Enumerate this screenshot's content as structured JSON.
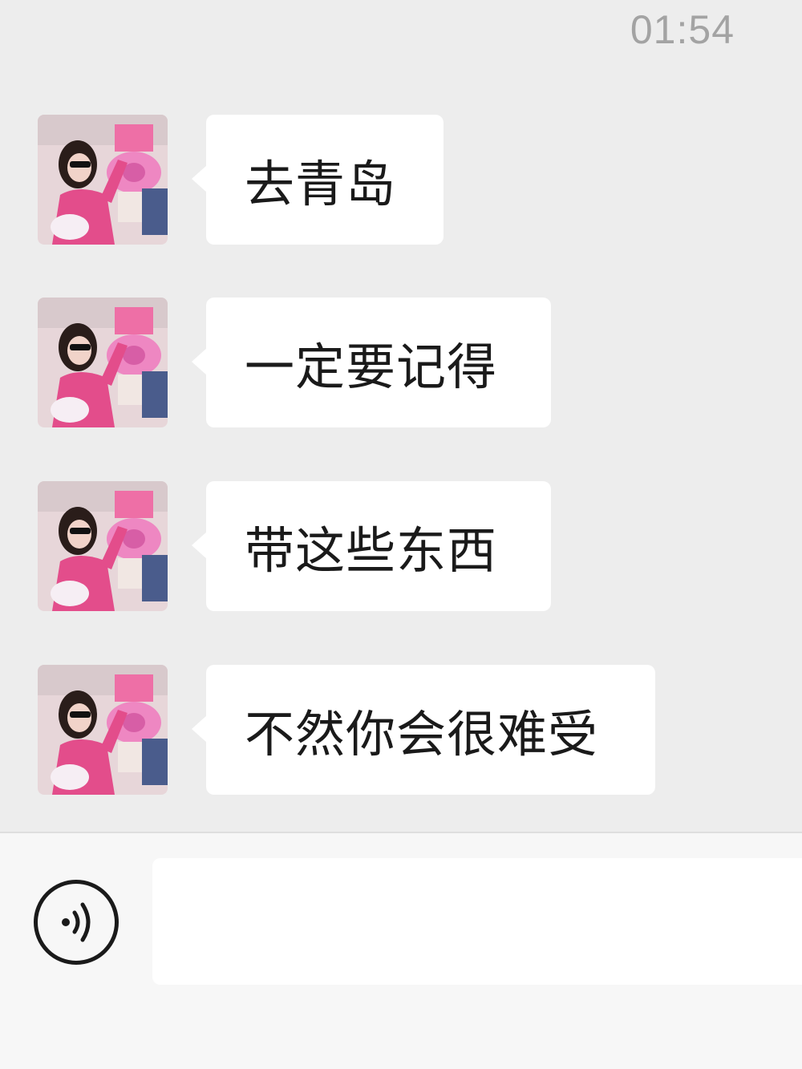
{
  "status": {
    "time": "01:54"
  },
  "messages": [
    {
      "sender": "contact",
      "text": "去青岛"
    },
    {
      "sender": "contact",
      "text": "一定要记得"
    },
    {
      "sender": "contact",
      "text": "带这些东西"
    },
    {
      "sender": "contact",
      "text": "不然你会很难受"
    }
  ],
  "input_bar": {
    "voice_icon": "voice-wave-icon",
    "text_value": ""
  },
  "colors": {
    "chat_background": "#ededed",
    "bubble": "#ffffff",
    "input_bar_background": "#f7f7f7",
    "timestamp_text": "#a3a3a3"
  }
}
